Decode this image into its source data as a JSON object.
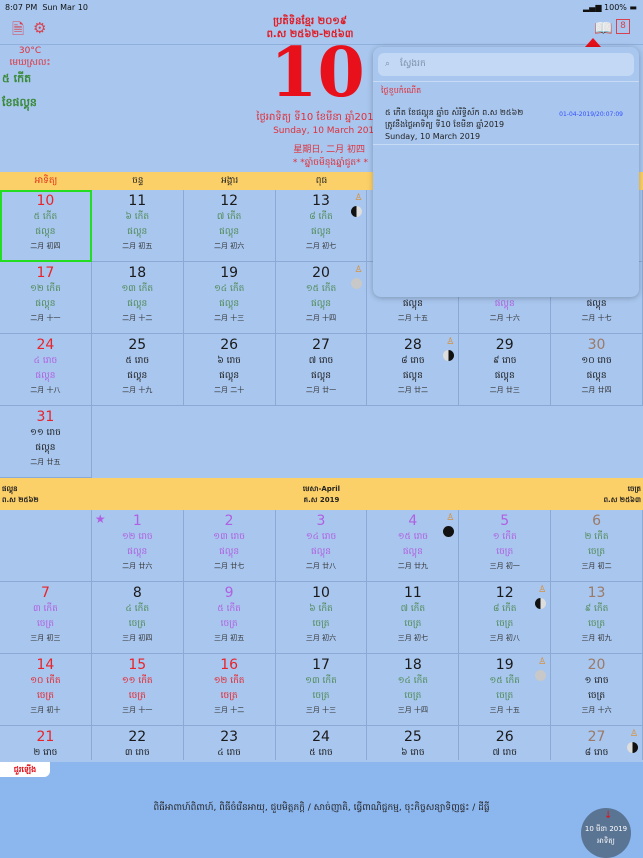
{
  "status": {
    "time": "8:07 PM",
    "date": "Sun Mar 10",
    "battery": "100%"
  },
  "toolbar": {
    "left_icons": [
      "search-document-icon",
      "gear-icon"
    ],
    "right_icons": [
      "book-icon",
      "calendar-today-icon"
    ]
  },
  "header": {
    "title": "ប្រតិទិនខ្មែរ ២០១៩",
    "era": "ព.ស ២៥៦២-២៥៦៣",
    "day": "10",
    "khmer_date": "ថ្ងៃអាទិត្យ ទី10 ខែមីនា ឆ្នាំ2019",
    "english_date": "Sunday, 10 March 2019",
    "chinese_date": "星期日, 二月 初四",
    "zodiac": "* *ឆ្នាំចមិនុងឆ្នាំជូត* *"
  },
  "weather": {
    "temp": "30°C",
    "condition": "មេឃស្រលះ",
    "lunar_day": "៥ កើត",
    "lunar_month": "ខែផល្គុន"
  },
  "weekdays": [
    "អាទិត្យ",
    "ចន្ទ",
    "អង្គារ",
    "ពុធ"
  ],
  "colors": {
    "red": "#e8232a",
    "green": "#4f8a55",
    "purple": "#b060e0",
    "brown": "#9a7a68",
    "black": "#1a1a1a",
    "accent_bar": "#fcd068",
    "background": "#a8c6ee"
  },
  "month1": [
    [
      "10",
      "r",
      "៥ កើត",
      "g",
      "ផល្គុន",
      "g",
      "二月 初四",
      "",
      1
    ],
    [
      "11",
      "k",
      "៦ កើត",
      "g",
      "ផល្គុន",
      "g",
      "二月 初五",
      ""
    ],
    [
      "12",
      "k",
      "៧ កើត",
      "g",
      "ផល្គុន",
      "g",
      "二月 初六",
      ""
    ],
    [
      "13",
      "k",
      "៨ កើត",
      "g",
      "ផល្គុន",
      "g",
      "二月 初七",
      "half"
    ],
    [
      "",
      "",
      "",
      "",
      "",
      "",
      "",
      ""
    ],
    [
      "",
      "",
      "",
      "",
      "",
      "",
      "",
      ""
    ],
    [
      "",
      "",
      "",
      "",
      "",
      "",
      "",
      ""
    ],
    [
      "17",
      "r",
      "១២ កើត",
      "g",
      "ផល្គុន",
      "g",
      "二月 十一",
      ""
    ],
    [
      "18",
      "k",
      "១៣ កើត",
      "g",
      "ផល្គុន",
      "g",
      "二月 十二",
      ""
    ],
    [
      "19",
      "k",
      "១៤ កើត",
      "g",
      "ផល្គុន",
      "g",
      "二月 十三",
      ""
    ],
    [
      "20",
      "k",
      "១៥ កើត",
      "g",
      "ផល្គុន",
      "g",
      "二月 十四",
      "full"
    ],
    [
      "",
      "",
      "",
      "",
      "ផល្គុន",
      "k",
      "二月 十五",
      ""
    ],
    [
      "",
      "",
      "",
      "",
      "ផល្គុន",
      "p",
      "二月 十六",
      ""
    ],
    [
      "",
      "",
      "",
      "",
      "ផល្គុន",
      "k",
      "二月 十七",
      ""
    ],
    [
      "24",
      "r",
      "៤ រោច",
      "p",
      "ផល្គុន",
      "p",
      "二月 十八",
      ""
    ],
    [
      "25",
      "k",
      "៥ រោច",
      "k",
      "ផល្គុន",
      "k",
      "二月 十九",
      ""
    ],
    [
      "26",
      "k",
      "៦ រោច",
      "k",
      "ផល្គុន",
      "k",
      "二月 二十",
      ""
    ],
    [
      "27",
      "k",
      "៧ រោច",
      "k",
      "ផល្គុន",
      "k",
      "二月 廿一",
      ""
    ],
    [
      "28",
      "k",
      "៨ រោច",
      "k",
      "ផល្គុន",
      "k",
      "二月 廿二",
      "half2"
    ],
    [
      "29",
      "k",
      "៩ រោច",
      "k",
      "ផល្គុន",
      "k",
      "二月 廿三",
      ""
    ],
    [
      "30",
      "b",
      "១០ រោច",
      "k",
      "ផល្គុន",
      "k",
      "二月 廿四",
      ""
    ],
    [
      "31",
      "r",
      "១១ រោច",
      "k",
      "ផល្គុន",
      "k",
      "二月 廿五",
      ""
    ]
  ],
  "month2_header": {
    "left_month": "ផល្គុន",
    "left_era": "ព.ស ២៥៦២",
    "center_month": "មេសា-April",
    "center_year": "គ.ស 2019",
    "right_month": "ចេត្រ",
    "right_era": "ព.ស ២៥៦៣"
  },
  "month2": [
    [
      "",
      "",
      "",
      "",
      "",
      "",
      "",
      ""
    ],
    [
      "1",
      "p",
      "១២ រោច",
      "p",
      "ផល្គុន",
      "p",
      "二月 廿六",
      "",
      0,
      1
    ],
    [
      "2",
      "p",
      "១៣ រោច",
      "p",
      "ផល្គុន",
      "p",
      "二月 廿七",
      ""
    ],
    [
      "3",
      "p",
      "១៤ រោច",
      "p",
      "ផល្គុន",
      "p",
      "二月 廿八",
      ""
    ],
    [
      "4",
      "p",
      "១៥ រោច",
      "p",
      "ផល្គុន",
      "p",
      "二月 廿九",
      "new"
    ],
    [
      "5",
      "p",
      "១ កើត",
      "p",
      "ចេត្រ",
      "p",
      "三月 初一",
      ""
    ],
    [
      "6",
      "b",
      "២ កើត",
      "g",
      "ចេត្រ",
      "g",
      "三月 初二",
      ""
    ],
    [
      "7",
      "r",
      "៣ កើត",
      "p",
      "ចេត្រ",
      "p",
      "三月 初三",
      ""
    ],
    [
      "8",
      "k",
      "៤ កើត",
      "g",
      "ចេត្រ",
      "g",
      "三月 初四",
      ""
    ],
    [
      "9",
      "p",
      "៥ កើត",
      "p",
      "ចេត្រ",
      "p",
      "三月 初五",
      ""
    ],
    [
      "10",
      "k",
      "៦ កើត",
      "g",
      "ចេត្រ",
      "g",
      "三月 初六",
      ""
    ],
    [
      "11",
      "k",
      "៧ កើត",
      "g",
      "ចេត្រ",
      "g",
      "三月 初七",
      ""
    ],
    [
      "12",
      "k",
      "៨ កើត",
      "g",
      "ចេត្រ",
      "g",
      "三月 初八",
      "half"
    ],
    [
      "13",
      "b",
      "៩ កើត",
      "g",
      "ចេត្រ",
      "g",
      "三月 初九",
      ""
    ],
    [
      "14",
      "r",
      "១០ កើត",
      "r",
      "ចេត្រ",
      "r",
      "三月 初十",
      ""
    ],
    [
      "15",
      "r",
      "១១ កើត",
      "r",
      "ចេត្រ",
      "r",
      "三月 十一",
      ""
    ],
    [
      "16",
      "r",
      "១២ កើត",
      "r",
      "ចេត្រ",
      "r",
      "三月 十二",
      ""
    ],
    [
      "17",
      "k",
      "១៣ កើត",
      "g",
      "ចេត្រ",
      "g",
      "三月 十三",
      ""
    ],
    [
      "18",
      "k",
      "១៤ កើត",
      "g",
      "ចេត្រ",
      "g",
      "三月 十四",
      ""
    ],
    [
      "19",
      "k",
      "១៥ កើត",
      "g",
      "ចេត្រ",
      "g",
      "三月 十五",
      "full"
    ],
    [
      "20",
      "b",
      "១ រោច",
      "k",
      "ចេត្រ",
      "k",
      "三月 十六",
      ""
    ],
    [
      "21",
      "r",
      "២ រោច",
      "k",
      "",
      "",
      "",
      ""
    ],
    [
      "22",
      "k",
      "៣ រោច",
      "k",
      "",
      "",
      "",
      ""
    ],
    [
      "23",
      "k",
      "៤ រោច",
      "k",
      "",
      "",
      "",
      ""
    ],
    [
      "24",
      "k",
      "៥ រោច",
      "k",
      "",
      "",
      "",
      ""
    ],
    [
      "25",
      "k",
      "៦ រោច",
      "k",
      "",
      "",
      "",
      ""
    ],
    [
      "26",
      "k",
      "៧ រោច",
      "k",
      "",
      "",
      "",
      ""
    ],
    [
      "27",
      "b",
      "៨ រោច",
      "k",
      "",
      "",
      "",
      "half2"
    ]
  ],
  "popup": {
    "search_placeholder": "ស្វែងរក",
    "section": "ថ្ងៃខួបកំណើត",
    "entry": {
      "line1": "៥ កើត ខែផល្គុន ឆ្នាំច សំរឹទ្ធិស័ក ព.ស ២៥៦២",
      "line2": "ត្រូវនឹងថ្ងៃអាទិត្យ ទី10 ខែមីនា ឆ្នាំ2019",
      "line3": "Sunday, 10 March 2019",
      "timestamp": "01-04-2019/20:07:09"
    }
  },
  "bottom": {
    "badge": "ជួរឡើង",
    "text": "ពិធីអាពាហ៍ពិពាហ៍, ពិធីចំរើនអាយុ, ជួបមិត្តភក្តិ / សាច់ញាតិ, ធ្វើពាណិជ្ជកម្ម, ចុះកិច្ចសន្យាទិញផ្ទះ / ដីធ្លី",
    "circle_date": "10 មីនា 2019",
    "circle_day": "អាទិត្យ"
  }
}
